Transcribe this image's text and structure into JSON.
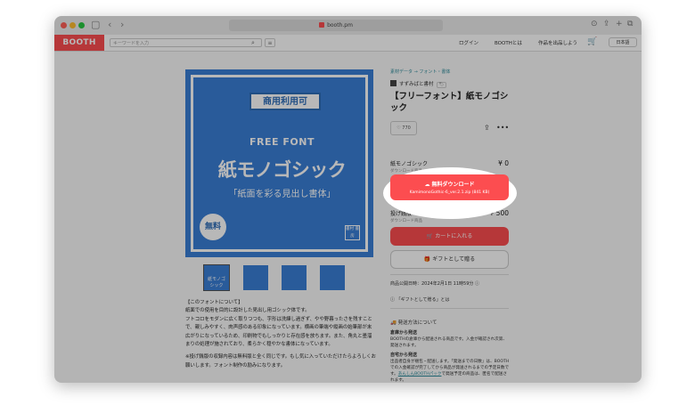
{
  "browser": {
    "url": "booth.pm"
  },
  "header": {
    "logo": "BOOTH",
    "search_placeholder": "キーワードを入力",
    "login": "ログイン",
    "about": "BOOTHとは",
    "sell": "作品を出品しよう",
    "lang": "日本語"
  },
  "product": {
    "breadcrumb": "素材データ → フォント・書体",
    "shop": "すずみばと書村",
    "shop_tag": "🏷",
    "title": "【フリーフォント】紙モノゴシック",
    "likes": "770",
    "image": {
      "badge": "商用利用可",
      "free_font": "FREE FONT",
      "name": "紙モノゴシック",
      "subtitle": "「紙面を彩る見出し書体」",
      "stamp": "無料",
      "seal": "書村 書房"
    },
    "variants": [
      {
        "name": "紙モノゴシック",
        "type": "ダウンロード商品",
        "price": "¥ 0"
      },
      {
        "name": "投げ銭版",
        "type": "ダウンロード商品",
        "price": "¥ 500"
      }
    ],
    "download": {
      "label": "無料ダウンロード",
      "file": "KamimonoGothic-6_ver.2.1.zip (841 KB)"
    },
    "cart_label": "カートに入れる",
    "gift_label": "ギフトとして贈る",
    "pub_date": "商品公開日時：2024年2月1日 11時59分",
    "gift_link": "「ギフトとして贈る」とは",
    "shipping": {
      "heading": "発送方法について",
      "method1_title": "倉庫から発送",
      "method1_text": "BOOTHの倉庫から配送される商品です。入金が確認され次第、発送されます。",
      "method2_title": "自宅から発送",
      "method2_text": "出品者自身が梱包・配送します。「発送までの日数」は、BOOTHでの入金確認が完了してから商品が発送されるまでの予定日数です。",
      "link_text": "あんしんBOOTHパック",
      "link_suffix": "で発送予定の商品は、匿名で配送されます。"
    },
    "description": [
      "【このフォントについて】",
      "紙面での使用を目的に設計した見出し用ゴシック体です。",
      "フトコロをモダンに広く取りつつも、字形は洗練し過ぎず、やや野暮ったさを残すことで、親しみやすく、肉声感のある印象になっています。横画の筆端や縦画の始筆部が末広がりになっているため、印刷物でもしっかりと存在感を放ちます。また、角丸と墨溜まりの処理が施されており、柔らかく穏やかな書体になっています。",
      "※投げ銭版の収録内容は無料版と全く同じです。もし気に入っていただけたらよろしくお願いします。フォント制作の励みになります。"
    ]
  }
}
